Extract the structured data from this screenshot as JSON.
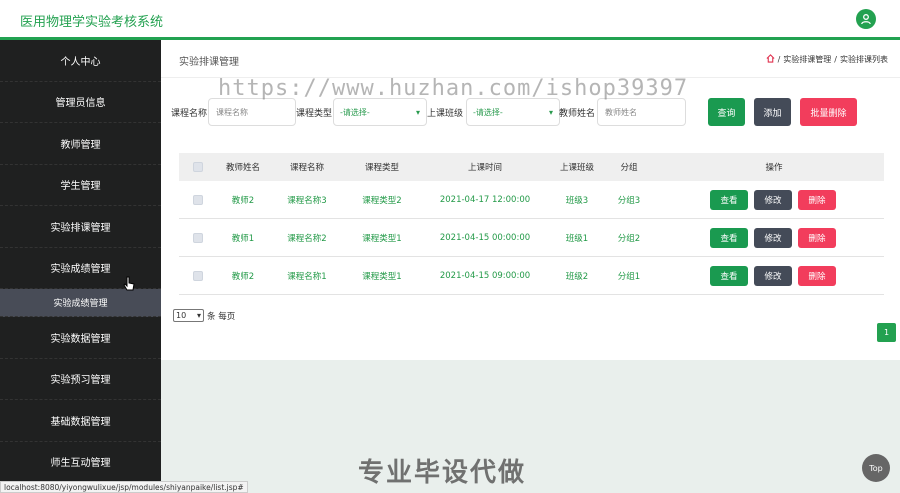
{
  "header": {
    "title": "医用物理学实验考核系统",
    "user_icon": "user-icon"
  },
  "sidebar": {
    "items": [
      {
        "label": "个人中心"
      },
      {
        "label": "管理员信息"
      },
      {
        "label": "教师管理"
      },
      {
        "label": "学生管理"
      },
      {
        "label": "实验排课管理"
      },
      {
        "label": "实验成绩管理"
      },
      {
        "label": "实验成绩管理"
      },
      {
        "label": "实验数据管理"
      },
      {
        "label": "实验预习管理"
      },
      {
        "label": "基础数据管理"
      },
      {
        "label": "师生互动管理"
      }
    ]
  },
  "breadcrumb": {
    "page_title": "实验排课管理",
    "home_icon": "home-icon",
    "level1": "实验排课管理",
    "sep": "/",
    "level2": "实验排课列表"
  },
  "search": {
    "course_name_label": "课程名称",
    "course_name_placeholder": "课程名称",
    "course_type_label": "课程类型",
    "course_type_value": "-请选择-",
    "class_label": "上课班级",
    "class_value": "-请选择-",
    "teacher_label": "教师姓名",
    "teacher_placeholder": "教师姓名",
    "query_button": "查询",
    "add_button": "添加",
    "batch_delete_button": "批量删除"
  },
  "table": {
    "headers": [
      "教师姓名",
      "课程名称",
      "课程类型",
      "上课时间",
      "上课班级",
      "分组",
      "操作"
    ],
    "rows": [
      {
        "teacher": "教师2",
        "course": "课程名称3",
        "type": "课程类型2",
        "time": "2021-04-17 12:00:00",
        "class": "班级3",
        "group": "分组3"
      },
      {
        "teacher": "教师1",
        "course": "课程名称2",
        "type": "课程类型1",
        "time": "2021-04-15 00:00:00",
        "class": "班级1",
        "group": "分组2"
      },
      {
        "teacher": "教师2",
        "course": "课程名称1",
        "type": "课程类型1",
        "time": "2021-04-15 09:00:00",
        "class": "班级2",
        "group": "分组1"
      }
    ],
    "view_label": "查看",
    "edit_label": "修改",
    "delete_label": "删除"
  },
  "pagination": {
    "page_size": "10",
    "page_size_suffix": "条 每页",
    "current_page": "1"
  },
  "overlay": {
    "watermark": "https://www.huzhan.com/ishop39397",
    "slogan": "专业毕设代做",
    "top_button": "Top",
    "status_url": "localhost:8080/yiyongwulixue/jsp/modules/shiyanpaike/list.jsp#"
  },
  "colors": {
    "brand": "#23a150",
    "dark_button": "#444b58",
    "danger": "#f23d5c",
    "sidebar_bg": "#1f2020"
  }
}
